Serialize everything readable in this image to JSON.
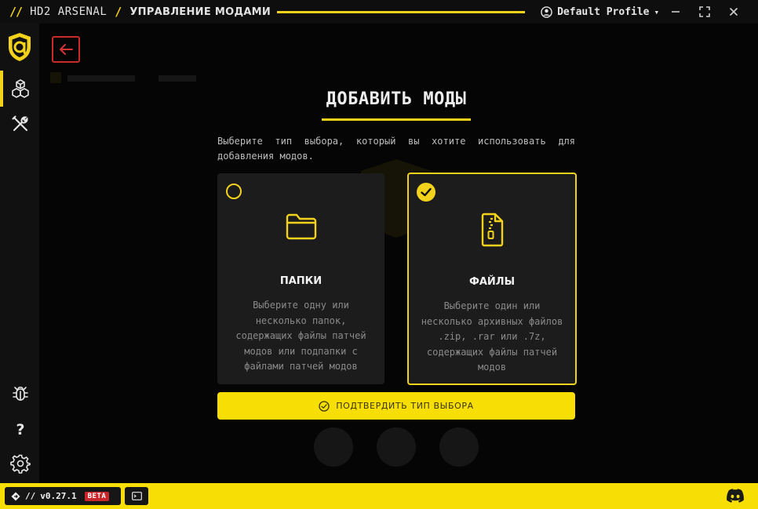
{
  "titlebar": {
    "slashes": "//",
    "app_name": "HD2 ARSENAL",
    "separator": "/",
    "page_name": "УПРАВЛЕНИЕ МОДАМИ",
    "profile": "Default Profile",
    "caret": "▾"
  },
  "main": {
    "heading": "ДОБАВИТЬ МОДЫ",
    "description": "Выберите тип выбора, который вы хотите использовать для добавления модов.",
    "cards": [
      {
        "title": "ПАПКИ",
        "description": "Выберите одну или несколько папок, содержащих файлы патчей модов или подпапки с файлами патчей модов",
        "selected": false,
        "icon": "folder-icon"
      },
      {
        "title": "ФАЙЛЫ",
        "description": "Выберите один или несколько архивных файлов .zip, .rar или .7z, содержащих файлы патчей модов",
        "selected": true,
        "icon": "zip-file-icon"
      }
    ],
    "confirm_label": "ПОДТВЕРДИТЬ ТИП ВЫБОРА"
  },
  "footer": {
    "version_slashes": "//",
    "version": "v0.27.1",
    "beta": "BETA"
  },
  "colors": {
    "accent": "#f3d21b",
    "back_border": "#c92b2b",
    "beta": "#c9262c"
  }
}
